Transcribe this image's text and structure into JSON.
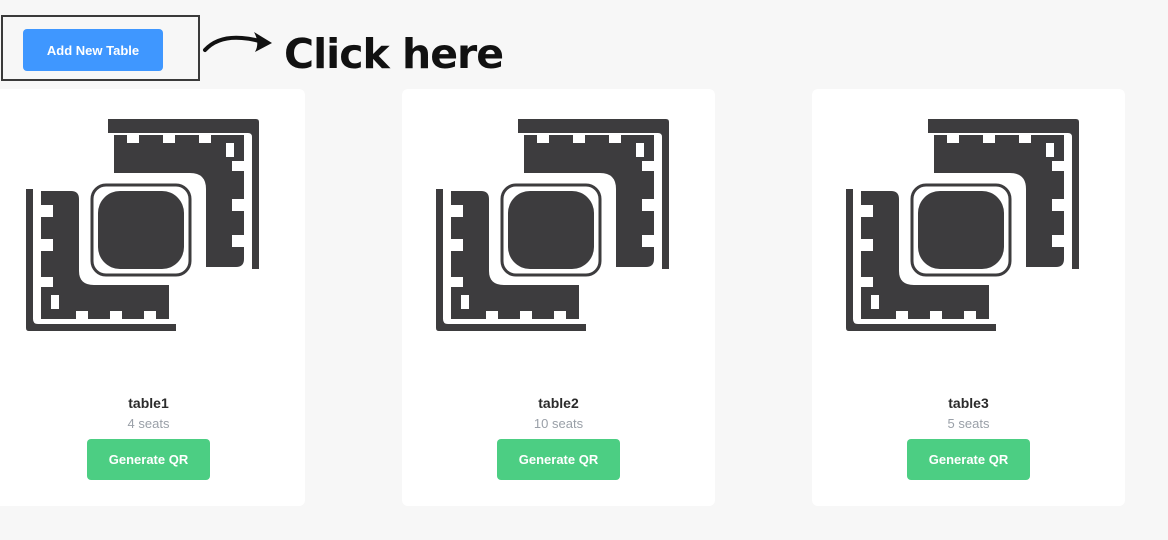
{
  "toolbar": {
    "add_button_label": "Add New Table"
  },
  "annotation": {
    "text": "Click here",
    "icon": "curved-arrow-right-icon"
  },
  "tables": [
    {
      "name": "table1",
      "seats": "4 seats",
      "button_label": "Generate QR",
      "icon": "dining-table-icon"
    },
    {
      "name": "table2",
      "seats": "10 seats",
      "button_label": "Generate QR",
      "icon": "dining-table-icon"
    },
    {
      "name": "table3",
      "seats": "5 seats",
      "button_label": "Generate QR",
      "icon": "dining-table-icon"
    }
  ],
  "colors": {
    "primary": "#3f97ff",
    "success": "#4cce83",
    "icon": "#3d3c3e",
    "background": "#f7f7f7",
    "card": "#ffffff"
  }
}
